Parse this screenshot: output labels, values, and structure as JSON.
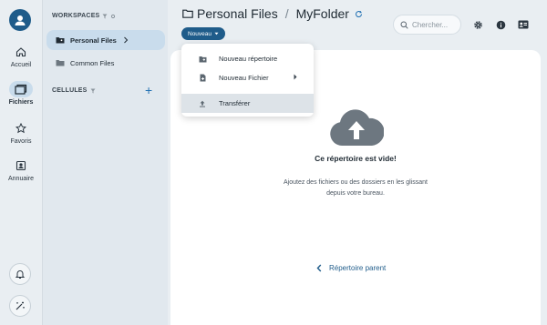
{
  "rail": {
    "items": [
      {
        "label": "Accueil",
        "icon": "home-icon"
      },
      {
        "label": "Fichiers",
        "icon": "folders-icon",
        "active": true
      },
      {
        "label": "Favoris",
        "icon": "star-icon"
      },
      {
        "label": "Annuaire",
        "icon": "contacts-icon"
      }
    ],
    "bottom": [
      {
        "icon": "bell-icon"
      },
      {
        "icon": "magic-icon"
      }
    ]
  },
  "panel": {
    "workspaces_title": "WORKSPACES",
    "workspaces": [
      {
        "label": "Personal Files",
        "active": true
      },
      {
        "label": "Common Files"
      }
    ],
    "cells_title": "CELLULES",
    "add_symbol": "+"
  },
  "header": {
    "crumbs": [
      "Personal Files",
      "MyFolder"
    ],
    "separator": "/",
    "new_button": "Nouveau",
    "search_placeholder": "Chercher..."
  },
  "menu": {
    "items": [
      {
        "label": "Nouveau répertoire",
        "icon": "new-folder-icon"
      },
      {
        "label": "Nouveau Fichier",
        "icon": "new-file-icon",
        "submenu": true
      },
      {
        "label": "Transférer",
        "icon": "upload-icon",
        "highlighted": true
      }
    ]
  },
  "empty": {
    "title": "Ce répertoire est vide!",
    "text": "Ajoutez des fichiers ou des dossiers en les glissant depuis votre bureau.",
    "parent_link": "Répertoire parent"
  },
  "colors": {
    "accent": "#1f5c8a",
    "background": "#e9eef2",
    "active_item": "#c9dcec",
    "panel": "#e1e8ee"
  }
}
